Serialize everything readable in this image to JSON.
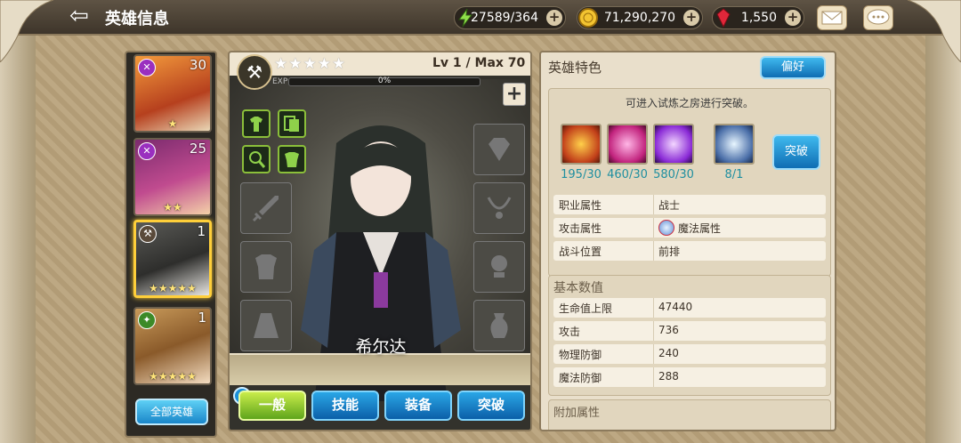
{
  "header": {
    "back_icon": "back-arrow-icon",
    "title": "英雄信息"
  },
  "resources": {
    "stamina": {
      "icon": "lightning-icon",
      "value": "27589/364"
    },
    "gold": {
      "icon": "gold-coin-icon",
      "value": "71,290,270"
    },
    "gems": {
      "icon": "red-gem-icon",
      "value": "1,550"
    }
  },
  "hero_list": {
    "items": [
      {
        "level": "30",
        "stars": "★",
        "class_color": "#9a2fbf"
      },
      {
        "level": "25",
        "stars": "★★",
        "class_color": "#9a2fbf"
      },
      {
        "level": "1",
        "stars": "★★★★★",
        "class_color": "#5a4a3a"
      },
      {
        "level": "1",
        "stars": "★★★★★",
        "class_color": "#3c8a28"
      }
    ],
    "all_label": "全部英雄"
  },
  "hero": {
    "stars": "★★★★★",
    "level": "Lv 1   / Max 70",
    "exp_label": "EXP",
    "exp_value": "0%",
    "exp_fraction": 0,
    "name": "希尔达",
    "class_icon": "axe-class-icon"
  },
  "tabs": [
    {
      "label": "一般",
      "active": true
    },
    {
      "label": "技能",
      "active": false
    },
    {
      "label": "装备",
      "active": false
    },
    {
      "label": "突破",
      "active": false
    }
  ],
  "right_panel": {
    "title": "英雄特色",
    "pref_label": "偏好",
    "breakthrough_note": "可进入试炼之房进行突破。",
    "materials": [
      {
        "count": "195/30",
        "icon": "fire-crystal-icon"
      },
      {
        "count": "460/30",
        "icon": "pink-crystal-icon"
      },
      {
        "count": "580/30",
        "icon": "purple-crystal-icon"
      },
      {
        "count": "8/1",
        "icon": "star-shard-icon"
      }
    ],
    "breakthrough_btn": "突破",
    "attributes": [
      {
        "k": "职业属性",
        "v": "战士"
      },
      {
        "k": "攻击属性",
        "v": "魔法属性"
      },
      {
        "k": "战斗位置",
        "v": "前排"
      }
    ],
    "stats_title": "基本数值",
    "stats": [
      {
        "k": "生命值上限",
        "v": "47440"
      },
      {
        "k": "攻击",
        "v": "736"
      },
      {
        "k": "物理防御",
        "v": "240"
      },
      {
        "k": "魔法防御",
        "v": "288"
      }
    ],
    "extra_title": "附加属性"
  }
}
